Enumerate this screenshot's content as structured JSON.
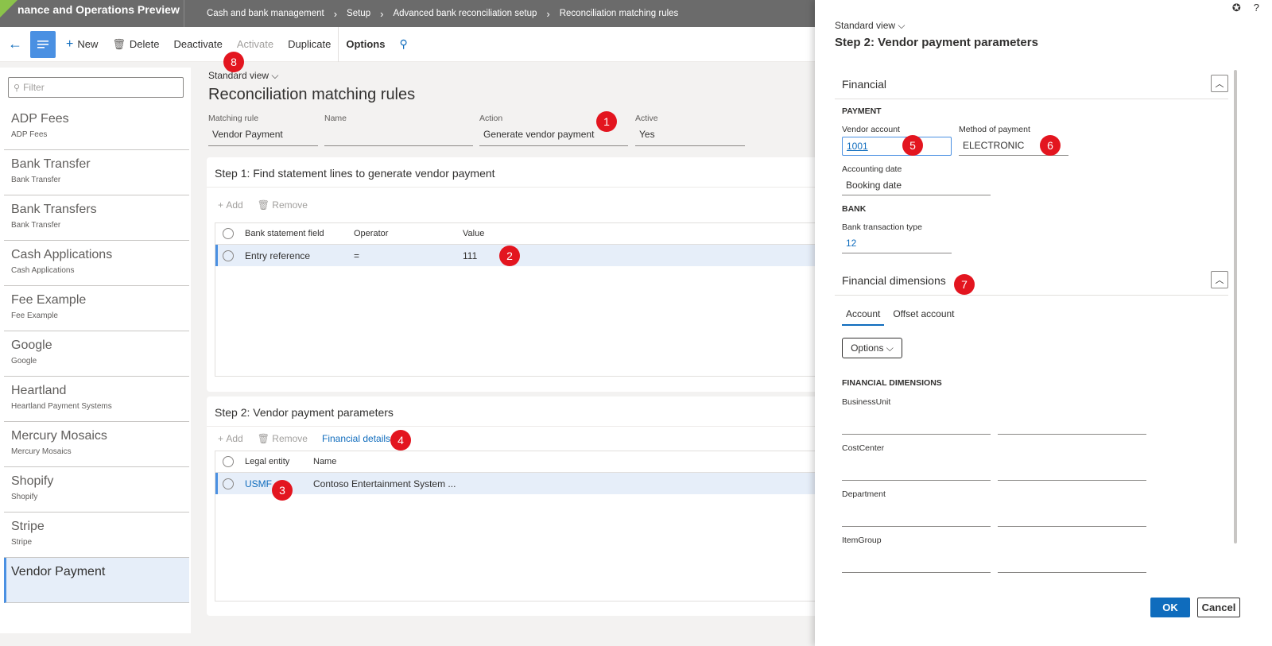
{
  "topbar": {
    "app_title": "nance and Operations Preview",
    "breadcrumbs": [
      "Cash and bank management",
      "Setup",
      "Advanced bank reconciliation setup",
      "Reconciliation matching rules"
    ]
  },
  "actionbar": {
    "new": "New",
    "delete": "Delete",
    "deactivate": "Deactivate",
    "activate": "Activate",
    "duplicate": "Duplicate",
    "options": "Options"
  },
  "left": {
    "filter_placeholder": "Filter",
    "items": [
      {
        "title": "ADP Fees",
        "sub": "ADP Fees"
      },
      {
        "title": "Bank Transfer",
        "sub": "Bank Transfer"
      },
      {
        "title": "Bank Transfers",
        "sub": "Bank Transfer"
      },
      {
        "title": "Cash Applications",
        "sub": "Cash Applications"
      },
      {
        "title": "Fee Example",
        "sub": "Fee Example"
      },
      {
        "title": "Google",
        "sub": "Google"
      },
      {
        "title": "Heartland",
        "sub": "Heartland Payment Systems"
      },
      {
        "title": "Mercury Mosaics",
        "sub": "Mercury Mosaics"
      },
      {
        "title": "Shopify",
        "sub": "Shopify"
      },
      {
        "title": "Stripe",
        "sub": "Stripe"
      },
      {
        "title": "Vendor Payment",
        "sub": ""
      }
    ]
  },
  "main": {
    "view": "Standard view",
    "title": "Reconciliation matching rules",
    "fields": {
      "matching_rule_label": "Matching rule",
      "matching_rule": "Vendor Payment",
      "name_label": "Name",
      "name": "",
      "action_label": "Action",
      "action": "Generate vendor payment",
      "active_label": "Active",
      "active": "Yes"
    },
    "step1": {
      "title": "Step 1: Find statement lines to generate vendor payment",
      "add": "Add",
      "remove": "Remove",
      "columns": [
        "Bank statement field",
        "Operator",
        "Value"
      ],
      "row": {
        "field": "Entry reference",
        "operator": "=",
        "value": "111"
      }
    },
    "step2": {
      "title": "Step 2: Vendor payment parameters",
      "add": "Add",
      "remove": "Remove",
      "financial_details": "Financial details",
      "columns": [
        "Legal entity",
        "Name"
      ],
      "row": {
        "entity": "USMF",
        "name": "Contoso Entertainment System ..."
      }
    }
  },
  "panel": {
    "view": "Standard view",
    "title": "Step 2: Vendor payment parameters",
    "financial": "Financial",
    "payment_group": "PAYMENT",
    "vendor_account_label": "Vendor account",
    "vendor_account": "1001",
    "method_label": "Method of payment",
    "method": "ELECTRONIC",
    "accounting_date_label": "Accounting date",
    "accounting_date": "Booking date",
    "bank_group": "BANK",
    "bank_tx_type_label": "Bank transaction type",
    "bank_tx_type": "12",
    "fin_dims": "Financial dimensions",
    "tab_account": "Account",
    "tab_offset": "Offset account",
    "options": "Options",
    "fin_dims_group": "FINANCIAL DIMENSIONS",
    "dims": [
      "BusinessUnit",
      "CostCenter",
      "Department",
      "ItemGroup"
    ],
    "ok": "OK",
    "cancel": "Cancel"
  },
  "badges": [
    "1",
    "2",
    "3",
    "4",
    "5",
    "6",
    "7",
    "8"
  ]
}
